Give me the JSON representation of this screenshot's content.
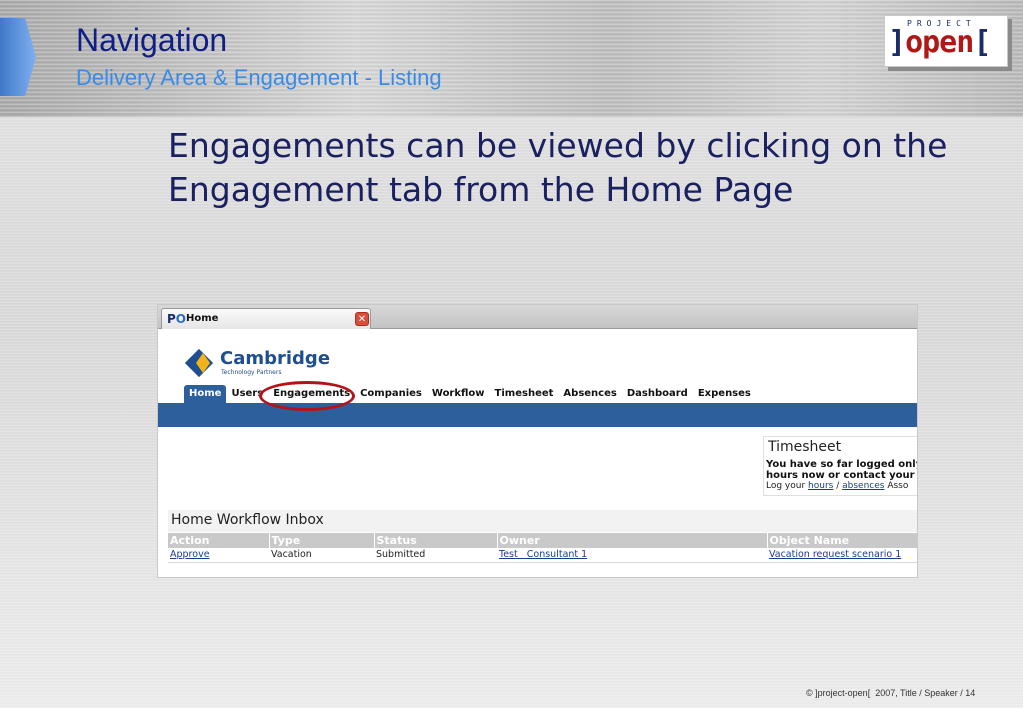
{
  "header": {
    "title": "Navigation",
    "subtitle": "Delivery Area & Engagement - Listing"
  },
  "logo": {
    "small_text": "PROJECT",
    "bracket_left": "]",
    "word": "open",
    "bracket_right": "["
  },
  "main": {
    "text_line1": "Engagements can be viewed by clicking on the",
    "text_line2": "Engagement tab from the Home Page"
  },
  "screenshot": {
    "browser_tab": {
      "favicon": "PO",
      "label": "Home",
      "close_icon": "close-icon"
    },
    "brand": {
      "name": "Cambridge",
      "tagline": "Technology Partners",
      "colors": {
        "primary": "#1f4f8f",
        "accent": "#f2b21b"
      }
    },
    "nav_tabs": [
      {
        "label": "Home",
        "active": true
      },
      {
        "label": "Users"
      },
      {
        "label": "Engagements"
      },
      {
        "label": "Companies"
      },
      {
        "label": "Workflow"
      },
      {
        "label": "Timesheet"
      },
      {
        "label": "Absences"
      },
      {
        "label": "Dashboard"
      },
      {
        "label": "Expenses"
      }
    ],
    "timesheet": {
      "title": "Timesheet",
      "line1": "You have so far logged only",
      "line2": "hours now or contact your m",
      "log_prefix": "Log your ",
      "hours_link": "hours",
      "separator": " / ",
      "absences_link": "absences",
      "suffix": " Asso"
    },
    "inbox": {
      "title": "Home Workflow Inbox",
      "columns": [
        "Action",
        "Type",
        "Status",
        "Owner",
        "Object Name"
      ],
      "rows": [
        {
          "action": "Approve",
          "type": "Vacation",
          "status": "Submitted",
          "owner": "Test   Consultant 1",
          "object_name": "Vacation request scenario 1"
        }
      ]
    }
  },
  "footer": {
    "symbol": "©",
    "text": "]project-open[  2007, Title / Speaker / 14"
  },
  "colors": {
    "title": "#101e86",
    "subtitle": "#3a8be8",
    "body_text": "#1a2060",
    "highlight_ring": "#b3141b",
    "app_nav_bar": "#2c5f9c"
  }
}
